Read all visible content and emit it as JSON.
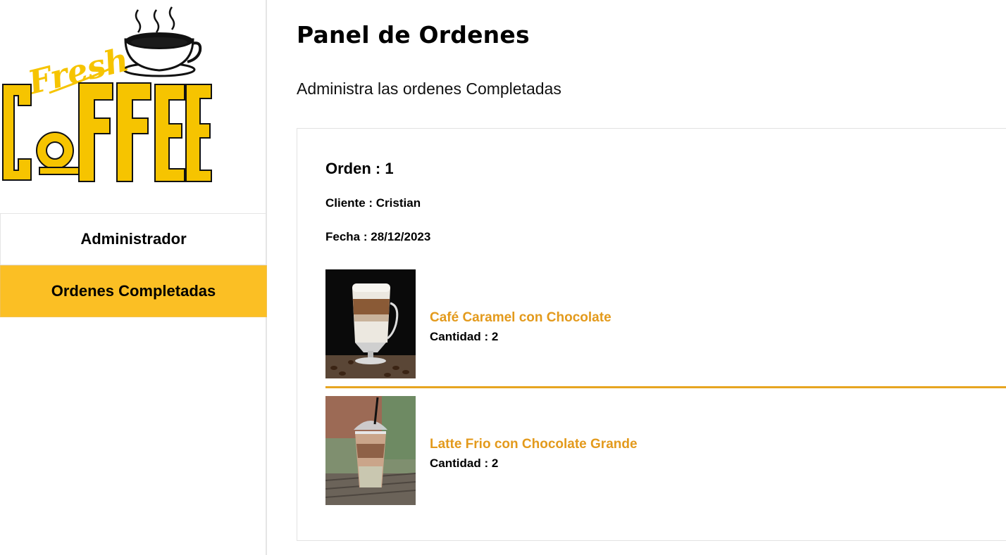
{
  "brand": {
    "logo_script": "Fresh",
    "logo_word": "COFFEE",
    "accent_color": "#fbbf24",
    "item_title_color": "#e39a1c"
  },
  "sidebar": {
    "items": [
      {
        "label": "Administrador",
        "active": false
      },
      {
        "label": "Ordenes Completadas",
        "active": true
      }
    ]
  },
  "main": {
    "title": "Panel de Ordenes",
    "subtitle": "Administra las ordenes Completadas"
  },
  "order": {
    "id_label": "Orden : 1",
    "client_label": "Cliente : Cristian",
    "date_label": "Fecha : 28/12/2023",
    "items": [
      {
        "name": "Café Caramel con Chocolate",
        "quantity_label": "Cantidad : 2",
        "image": "layered-latte-glass-photo"
      },
      {
        "name": "Latte Frio con Chocolate Grande",
        "quantity_label": "Cantidad : 2",
        "image": "iced-latte-cup-photo"
      }
    ]
  }
}
